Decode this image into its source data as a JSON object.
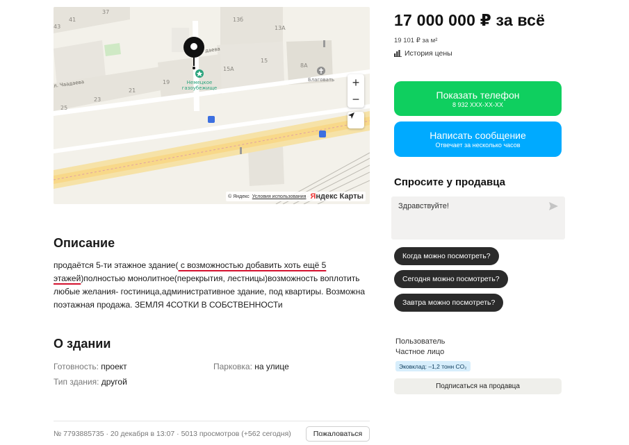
{
  "map": {
    "labels": {
      "n37": "37",
      "n41": "41",
      "n43": "43",
      "n13b": "13б",
      "n13a": "13А",
      "n15a": "15А",
      "n15": "15",
      "n8a": "8А",
      "n19": "19",
      "n21": "21",
      "n23": "23",
      "n25": "25",
      "street_chaadaeva": "л. Чаадаева",
      "street_deva": "даева",
      "poi_line1": "Немецкое",
      "poi_line2": "газоубежище",
      "church": "Благовать"
    },
    "zoom_in": "+",
    "zoom_out": "−",
    "copyright": "© Яндекс",
    "terms": "Условия использования",
    "brand_a": "Я",
    "brand_b": "ндекс Карты"
  },
  "description": {
    "title": "Описание",
    "part1": "продаётся 5-ти этажное здание(",
    "underlined": " с возможностью добавить хоть ещё 5 этажей",
    "part2": ")полностью монолитное(перекрытия, лестницы)возможность воплотить любые желания- гостиница,административное здание, под квартиры. Возможна поэтажная продажа. ЗЕМЛЯ 4СОТКИ В СОБСТВЕННОСТи"
  },
  "building": {
    "title": "О здании",
    "facts": [
      {
        "key": "Готовность:",
        "value": "проект"
      },
      {
        "key": "Парковка:",
        "value": "на улице"
      },
      {
        "key": "Тип здания:",
        "value": "другой"
      }
    ]
  },
  "meta": {
    "info": "№ 7793885735 · 20 декабря в 13:07 · 5013 просмотров (+562 сегодня)",
    "complain": "Пожаловаться"
  },
  "price": {
    "total": "17 000 000 ₽ за всё",
    "per_m2": "19 101 ₽ за м²",
    "history": "История цены"
  },
  "contact": {
    "phone_label": "Показать телефон",
    "phone_sub": "8 932 XXX-XX-XX",
    "message_label": "Написать сообщение",
    "message_sub": "Отвечает за несколько часов"
  },
  "ask": {
    "title": "Спросите у продавца",
    "message": "Здравствуйте!",
    "chips": [
      "Когда можно посмотреть?",
      "Сегодня можно посмотреть?",
      "Завтра можно посмотреть?"
    ]
  },
  "seller": {
    "line1": "Пользователь",
    "line2": "Частное лицо",
    "eco": "Эковклад: –1,2 тонн CO₂",
    "subscribe": "Подписаться на продавца"
  },
  "colors": {
    "green": "#0fcf5f",
    "blue": "#00aaff",
    "underline": "#d4112e",
    "chip": "#2b2b2b"
  }
}
